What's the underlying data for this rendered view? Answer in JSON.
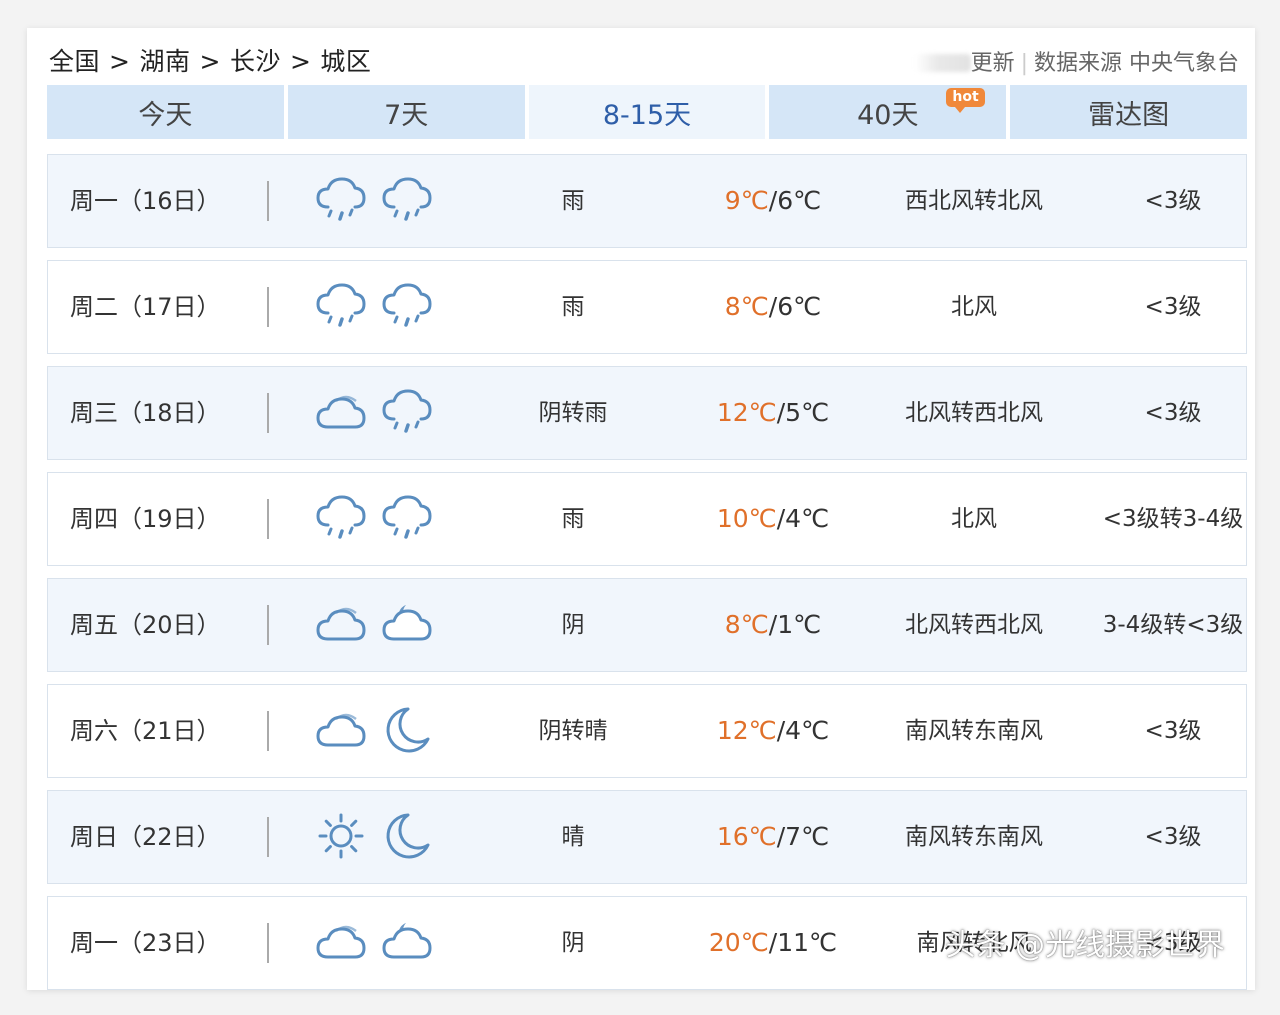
{
  "breadcrumb": [
    "全国",
    "湖南",
    "长沙",
    "城区"
  ],
  "breadcrumb_sep": ">",
  "source": {
    "update_label": "更新",
    "source_label": "数据来源 中央气象台"
  },
  "tabs": [
    {
      "label": "今天",
      "active": false
    },
    {
      "label": "7天",
      "active": false
    },
    {
      "label": "8-15天",
      "active": true
    },
    {
      "label": "40天",
      "active": false,
      "badge": "hot"
    },
    {
      "label": "雷达图",
      "active": false
    }
  ],
  "forecast": [
    {
      "date": "周一（16日）",
      "icon_day": "rain-cloud-icon",
      "icon_night": "rain-cloud-icon",
      "condition": "雨",
      "high": "9℃",
      "low": "6℃",
      "wind": "西北风转北风",
      "level": "<3级"
    },
    {
      "date": "周二（17日）",
      "icon_day": "rain-cloud-icon",
      "icon_night": "rain-cloud-icon",
      "condition": "雨",
      "high": "8℃",
      "low": "6℃",
      "wind": "北风",
      "level": "<3级"
    },
    {
      "date": "周三（18日）",
      "icon_day": "cloud-icon",
      "icon_night": "rain-cloud-icon",
      "condition": "阴转雨",
      "high": "12℃",
      "low": "5℃",
      "wind": "北风转西北风",
      "level": "<3级"
    },
    {
      "date": "周四（19日）",
      "icon_day": "rain-cloud-icon",
      "icon_night": "rain-cloud-icon",
      "condition": "雨",
      "high": "10℃",
      "low": "4℃",
      "wind": "北风",
      "level": "<3级转3-4级"
    },
    {
      "date": "周五（20日）",
      "icon_day": "cloud-icon",
      "icon_night": "cloud-moon-icon",
      "condition": "阴",
      "high": "8℃",
      "low": "1℃",
      "wind": "北风转西北风",
      "level": "3-4级转<3级"
    },
    {
      "date": "周六（21日）",
      "icon_day": "cloud-icon",
      "icon_night": "moon-icon",
      "condition": "阴转晴",
      "high": "12℃",
      "low": "4℃",
      "wind": "南风转东南风",
      "level": "<3级"
    },
    {
      "date": "周日（22日）",
      "icon_day": "sun-icon",
      "icon_night": "moon-icon",
      "condition": "晴",
      "high": "16℃",
      "low": "7℃",
      "wind": "南风转东南风",
      "level": "<3级"
    },
    {
      "date": "周一（23日）",
      "icon_day": "cloud-icon",
      "icon_night": "cloud-moon-icon",
      "condition": "阴",
      "high": "20℃",
      "low": "11℃",
      "wind": "南风转北风",
      "level": "<3级"
    }
  ],
  "watermark": "头条 @光线摄影世界",
  "colors": {
    "tab_bg": "#d5e6f7",
    "tab_active_text": "#2e5ea8",
    "row_alt_bg": "#f1f6fc",
    "temp_high": "#e0702a",
    "icon_stroke": "#5a8dbf",
    "hot_badge": "#f0883a"
  }
}
